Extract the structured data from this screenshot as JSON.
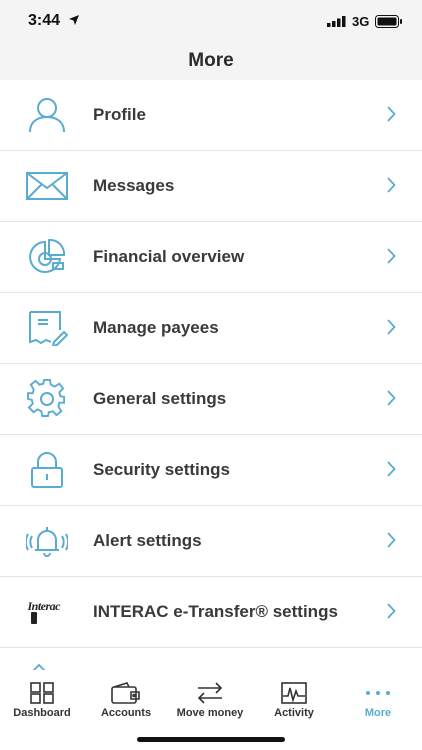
{
  "status": {
    "time": "3:44",
    "network": "3G"
  },
  "header": {
    "title": "More"
  },
  "menu": {
    "items": [
      {
        "label": "Profile",
        "icon": "profile-icon"
      },
      {
        "label": "Messages",
        "icon": "envelope-icon"
      },
      {
        "label": "Financial overview",
        "icon": "pie-chart-icon"
      },
      {
        "label": "Manage payees",
        "icon": "payee-document-icon"
      },
      {
        "label": "General settings",
        "icon": "gear-icon"
      },
      {
        "label": "Security settings",
        "icon": "lock-icon"
      },
      {
        "label": "Alert settings",
        "icon": "bell-icon"
      },
      {
        "label": "INTERAC e-Transfer® settings",
        "icon": "interac-logo",
        "logo_text": "Interac"
      }
    ]
  },
  "tabs": [
    {
      "label": "Dashboard",
      "icon": "dashboard-icon"
    },
    {
      "label": "Accounts",
      "icon": "wallet-icon"
    },
    {
      "label": "Move money",
      "icon": "transfer-arrows-icon"
    },
    {
      "label": "Activity",
      "icon": "activity-chart-icon"
    },
    {
      "label": "More",
      "icon": "more-dots-icon",
      "active": true
    }
  ],
  "colors": {
    "accent": "#5aabd0",
    "text": "#3a3a3a",
    "header_bg": "#f4f4f4",
    "divider": "#e5e5e5"
  }
}
